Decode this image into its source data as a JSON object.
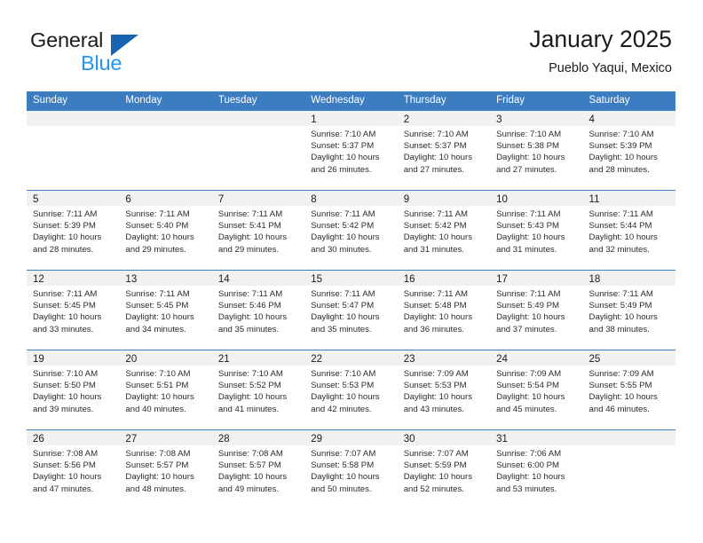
{
  "brand": {
    "name_top": "General",
    "name_bottom": "Blue",
    "accent_color": "#2196f3",
    "triangle_color": "#1565b0"
  },
  "header": {
    "title": "January 2025",
    "subtitle": "Pueblo Yaqui, Mexico"
  },
  "theme": {
    "header_row_bg": "#3b7dc0",
    "day_band_bg": "#f1f1f1",
    "row_border": "#3b7dc0",
    "text": "#2b2b2b"
  },
  "weekdays": [
    "Sunday",
    "Monday",
    "Tuesday",
    "Wednesday",
    "Thursday",
    "Friday",
    "Saturday"
  ],
  "weeks": [
    [
      {
        "day": "",
        "sunrise": "",
        "sunset": "",
        "daylight_a": "",
        "daylight_b": ""
      },
      {
        "day": "",
        "sunrise": "",
        "sunset": "",
        "daylight_a": "",
        "daylight_b": ""
      },
      {
        "day": "",
        "sunrise": "",
        "sunset": "",
        "daylight_a": "",
        "daylight_b": ""
      },
      {
        "day": "1",
        "sunrise": "Sunrise: 7:10 AM",
        "sunset": "Sunset: 5:37 PM",
        "daylight_a": "Daylight: 10 hours",
        "daylight_b": "and 26 minutes."
      },
      {
        "day": "2",
        "sunrise": "Sunrise: 7:10 AM",
        "sunset": "Sunset: 5:37 PM",
        "daylight_a": "Daylight: 10 hours",
        "daylight_b": "and 27 minutes."
      },
      {
        "day": "3",
        "sunrise": "Sunrise: 7:10 AM",
        "sunset": "Sunset: 5:38 PM",
        "daylight_a": "Daylight: 10 hours",
        "daylight_b": "and 27 minutes."
      },
      {
        "day": "4",
        "sunrise": "Sunrise: 7:10 AM",
        "sunset": "Sunset: 5:39 PM",
        "daylight_a": "Daylight: 10 hours",
        "daylight_b": "and 28 minutes."
      }
    ],
    [
      {
        "day": "5",
        "sunrise": "Sunrise: 7:11 AM",
        "sunset": "Sunset: 5:39 PM",
        "daylight_a": "Daylight: 10 hours",
        "daylight_b": "and 28 minutes."
      },
      {
        "day": "6",
        "sunrise": "Sunrise: 7:11 AM",
        "sunset": "Sunset: 5:40 PM",
        "daylight_a": "Daylight: 10 hours",
        "daylight_b": "and 29 minutes."
      },
      {
        "day": "7",
        "sunrise": "Sunrise: 7:11 AM",
        "sunset": "Sunset: 5:41 PM",
        "daylight_a": "Daylight: 10 hours",
        "daylight_b": "and 29 minutes."
      },
      {
        "day": "8",
        "sunrise": "Sunrise: 7:11 AM",
        "sunset": "Sunset: 5:42 PM",
        "daylight_a": "Daylight: 10 hours",
        "daylight_b": "and 30 minutes."
      },
      {
        "day": "9",
        "sunrise": "Sunrise: 7:11 AM",
        "sunset": "Sunset: 5:42 PM",
        "daylight_a": "Daylight: 10 hours",
        "daylight_b": "and 31 minutes."
      },
      {
        "day": "10",
        "sunrise": "Sunrise: 7:11 AM",
        "sunset": "Sunset: 5:43 PM",
        "daylight_a": "Daylight: 10 hours",
        "daylight_b": "and 31 minutes."
      },
      {
        "day": "11",
        "sunrise": "Sunrise: 7:11 AM",
        "sunset": "Sunset: 5:44 PM",
        "daylight_a": "Daylight: 10 hours",
        "daylight_b": "and 32 minutes."
      }
    ],
    [
      {
        "day": "12",
        "sunrise": "Sunrise: 7:11 AM",
        "sunset": "Sunset: 5:45 PM",
        "daylight_a": "Daylight: 10 hours",
        "daylight_b": "and 33 minutes."
      },
      {
        "day": "13",
        "sunrise": "Sunrise: 7:11 AM",
        "sunset": "Sunset: 5:45 PM",
        "daylight_a": "Daylight: 10 hours",
        "daylight_b": "and 34 minutes."
      },
      {
        "day": "14",
        "sunrise": "Sunrise: 7:11 AM",
        "sunset": "Sunset: 5:46 PM",
        "daylight_a": "Daylight: 10 hours",
        "daylight_b": "and 35 minutes."
      },
      {
        "day": "15",
        "sunrise": "Sunrise: 7:11 AM",
        "sunset": "Sunset: 5:47 PM",
        "daylight_a": "Daylight: 10 hours",
        "daylight_b": "and 35 minutes."
      },
      {
        "day": "16",
        "sunrise": "Sunrise: 7:11 AM",
        "sunset": "Sunset: 5:48 PM",
        "daylight_a": "Daylight: 10 hours",
        "daylight_b": "and 36 minutes."
      },
      {
        "day": "17",
        "sunrise": "Sunrise: 7:11 AM",
        "sunset": "Sunset: 5:49 PM",
        "daylight_a": "Daylight: 10 hours",
        "daylight_b": "and 37 minutes."
      },
      {
        "day": "18",
        "sunrise": "Sunrise: 7:11 AM",
        "sunset": "Sunset: 5:49 PM",
        "daylight_a": "Daylight: 10 hours",
        "daylight_b": "and 38 minutes."
      }
    ],
    [
      {
        "day": "19",
        "sunrise": "Sunrise: 7:10 AM",
        "sunset": "Sunset: 5:50 PM",
        "daylight_a": "Daylight: 10 hours",
        "daylight_b": "and 39 minutes."
      },
      {
        "day": "20",
        "sunrise": "Sunrise: 7:10 AM",
        "sunset": "Sunset: 5:51 PM",
        "daylight_a": "Daylight: 10 hours",
        "daylight_b": "and 40 minutes."
      },
      {
        "day": "21",
        "sunrise": "Sunrise: 7:10 AM",
        "sunset": "Sunset: 5:52 PM",
        "daylight_a": "Daylight: 10 hours",
        "daylight_b": "and 41 minutes."
      },
      {
        "day": "22",
        "sunrise": "Sunrise: 7:10 AM",
        "sunset": "Sunset: 5:53 PM",
        "daylight_a": "Daylight: 10 hours",
        "daylight_b": "and 42 minutes."
      },
      {
        "day": "23",
        "sunrise": "Sunrise: 7:09 AM",
        "sunset": "Sunset: 5:53 PM",
        "daylight_a": "Daylight: 10 hours",
        "daylight_b": "and 43 minutes."
      },
      {
        "day": "24",
        "sunrise": "Sunrise: 7:09 AM",
        "sunset": "Sunset: 5:54 PM",
        "daylight_a": "Daylight: 10 hours",
        "daylight_b": "and 45 minutes."
      },
      {
        "day": "25",
        "sunrise": "Sunrise: 7:09 AM",
        "sunset": "Sunset: 5:55 PM",
        "daylight_a": "Daylight: 10 hours",
        "daylight_b": "and 46 minutes."
      }
    ],
    [
      {
        "day": "26",
        "sunrise": "Sunrise: 7:08 AM",
        "sunset": "Sunset: 5:56 PM",
        "daylight_a": "Daylight: 10 hours",
        "daylight_b": "and 47 minutes."
      },
      {
        "day": "27",
        "sunrise": "Sunrise: 7:08 AM",
        "sunset": "Sunset: 5:57 PM",
        "daylight_a": "Daylight: 10 hours",
        "daylight_b": "and 48 minutes."
      },
      {
        "day": "28",
        "sunrise": "Sunrise: 7:08 AM",
        "sunset": "Sunset: 5:57 PM",
        "daylight_a": "Daylight: 10 hours",
        "daylight_b": "and 49 minutes."
      },
      {
        "day": "29",
        "sunrise": "Sunrise: 7:07 AM",
        "sunset": "Sunset: 5:58 PM",
        "daylight_a": "Daylight: 10 hours",
        "daylight_b": "and 50 minutes."
      },
      {
        "day": "30",
        "sunrise": "Sunrise: 7:07 AM",
        "sunset": "Sunset: 5:59 PM",
        "daylight_a": "Daylight: 10 hours",
        "daylight_b": "and 52 minutes."
      },
      {
        "day": "31",
        "sunrise": "Sunrise: 7:06 AM",
        "sunset": "Sunset: 6:00 PM",
        "daylight_a": "Daylight: 10 hours",
        "daylight_b": "and 53 minutes."
      },
      {
        "day": "",
        "sunrise": "",
        "sunset": "",
        "daylight_a": "",
        "daylight_b": ""
      }
    ]
  ]
}
